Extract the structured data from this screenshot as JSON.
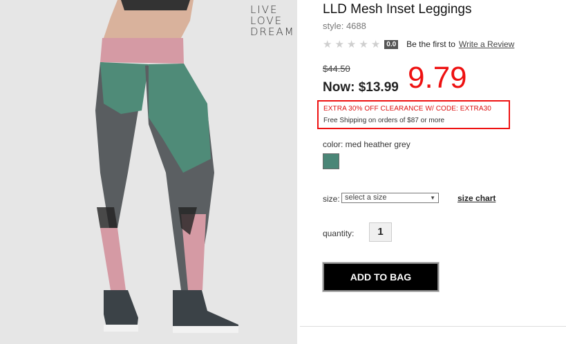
{
  "product": {
    "title": "LLD Mesh Inset Leggings",
    "style": "style: 4688",
    "rating_badge": "0.0",
    "rating_text": "Be the first to",
    "review_link": "Write a Review",
    "original_price": "$44.50",
    "now_price": "Now: $13.99",
    "handwritten_price": "9.79",
    "promo_code": "EXTRA 30% OFF CLEARANCE W/ CODE: EXTRA30",
    "shipping": "Free Shipping on orders of $87 or more",
    "color_label": "color: med heather grey",
    "swatch_color": "#4a8677",
    "size_label": "size:",
    "size_placeholder": "select a size",
    "size_chart": "size chart",
    "quantity_label": "quantity:",
    "quantity_value": "1",
    "add_to_bag": "ADD TO BAG"
  },
  "brand": {
    "line1": "LIVE",
    "line2": "LOVE",
    "line3": "DREAM"
  },
  "colors": {
    "promo_red": "#e11",
    "button_bg": "#000000",
    "pink": "#d49aa3",
    "green": "#4f8b78",
    "heather": "#5a5e60"
  }
}
